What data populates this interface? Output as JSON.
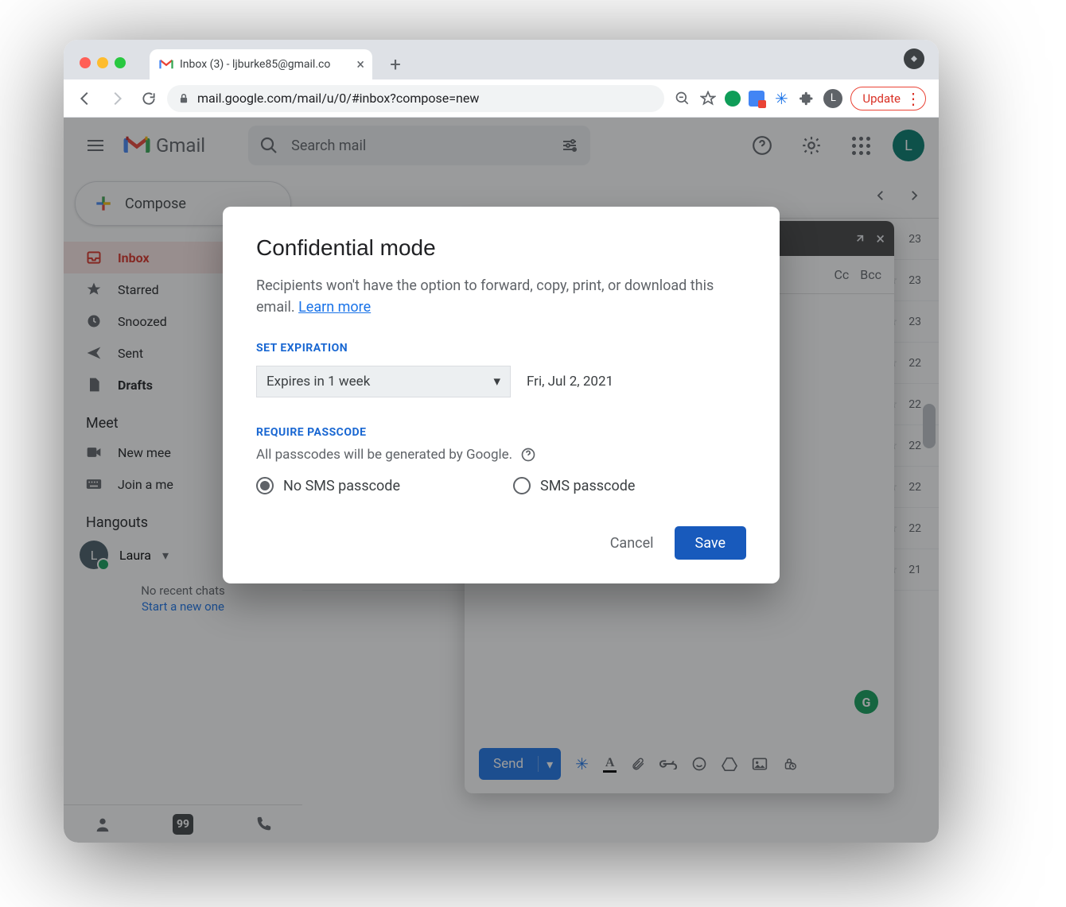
{
  "browser": {
    "tab_title": "Inbox (3) - ljburke85@gmail.co",
    "url": "mail.google.com/mail/u/0/#inbox?compose=new",
    "update_label": "Update",
    "avatar_letter": "L"
  },
  "gmail": {
    "brand": "Gmail",
    "search_placeholder": "Search mail",
    "compose_label": "Compose",
    "sidebar": [
      {
        "icon": "inbox",
        "label": "Inbox",
        "active": true
      },
      {
        "icon": "star",
        "label": "Starred"
      },
      {
        "icon": "clock",
        "label": "Snoozed"
      },
      {
        "icon": "send",
        "label": "Sent"
      },
      {
        "icon": "file",
        "label": "Drafts"
      }
    ],
    "meet_label": "Meet",
    "meet_items": [
      "New mee",
      "Join a me"
    ],
    "hangouts_label": "Hangouts",
    "hangouts_user": "Laura",
    "no_chats": "No recent chats",
    "start_new": "Start a new one",
    "avatar_letter": "L"
  },
  "messages": {
    "dates": [
      "23",
      "23",
      "23",
      "22",
      "22",
      "22",
      "22",
      "22",
      "21"
    ]
  },
  "compose_window": {
    "cc": "Cc",
    "bcc": "Bcc",
    "send": "Send"
  },
  "dialog": {
    "title": "Confidential mode",
    "description": "Recipients won't have the option to forward, copy, print, or download this email. ",
    "learn_more": "Learn more",
    "set_expiration_label": "SET EXPIRATION",
    "expiration_selected": "Expires in 1 week",
    "expiration_date": "Fri, Jul 2, 2021",
    "require_passcode_label": "REQUIRE PASSCODE",
    "passcode_desc": "All passcodes will be generated by Google.",
    "radio_no_sms": "No SMS passcode",
    "radio_sms": "SMS passcode",
    "cancel": "Cancel",
    "save": "Save"
  }
}
